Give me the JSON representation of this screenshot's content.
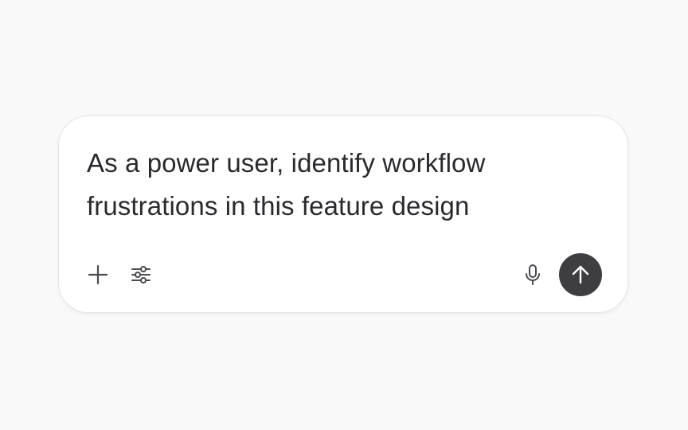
{
  "composer": {
    "prompt_text": "As a power user, identify workflow frustrations in this feature design"
  },
  "toolbar": {
    "left_icons": [
      "plus-icon",
      "sliders-icon"
    ],
    "right_icons": [
      "microphone-icon",
      "arrow-up-icon"
    ]
  },
  "colors": {
    "background": "#f9f9f9",
    "card": "#ffffff",
    "text": "#2a2a2e",
    "icon": "#4a4a4f",
    "send_button": "#3d3d42"
  }
}
